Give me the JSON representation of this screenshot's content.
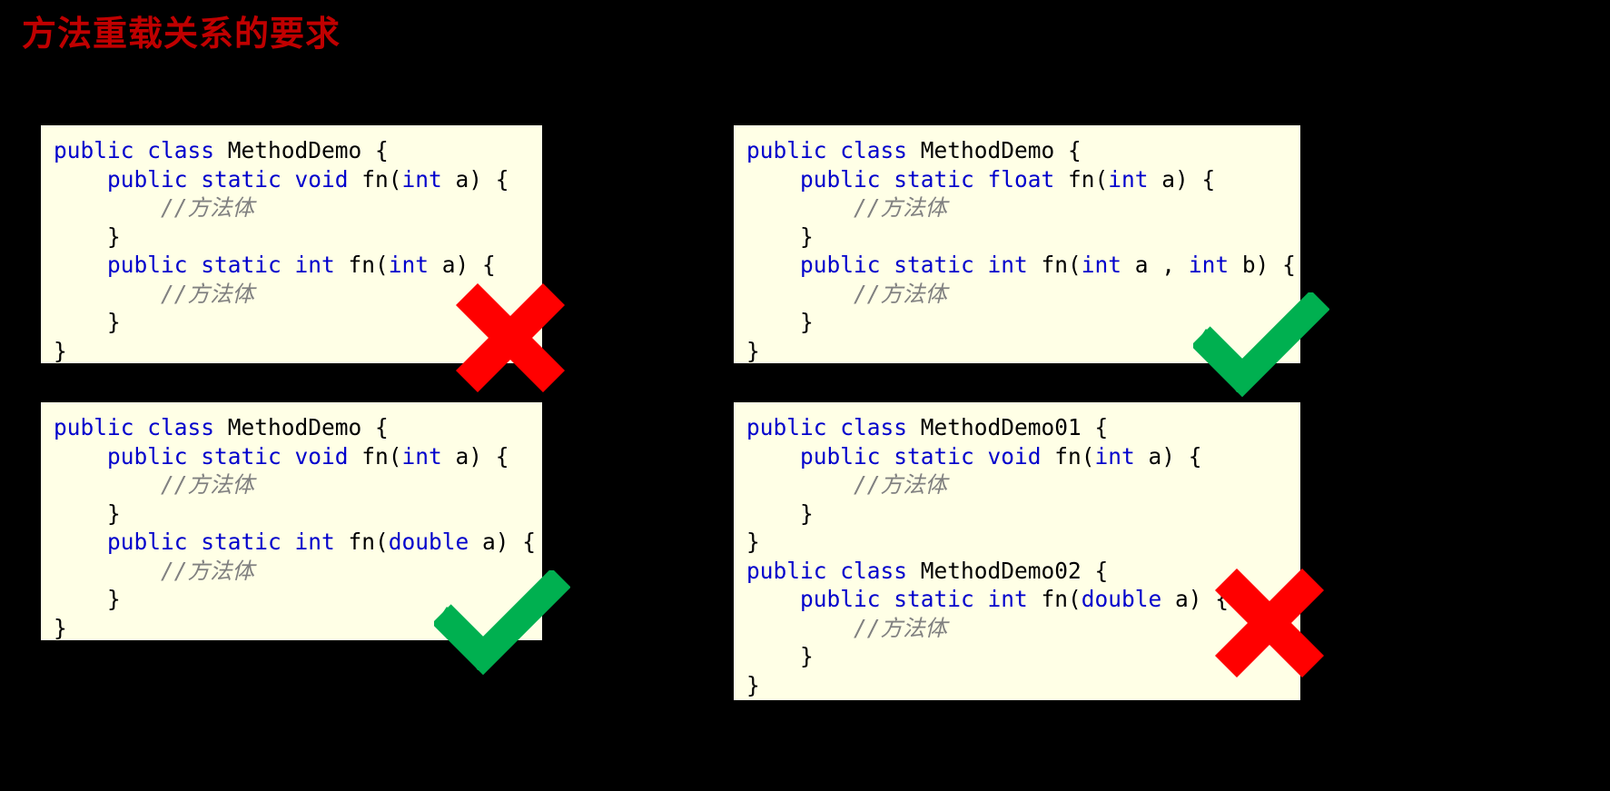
{
  "slide": {
    "title": "方法重载关系的要求",
    "title_color": "#C00000",
    "background_color": "#000000",
    "code_background_color": "#FFFFE6",
    "keyword_color": "#0000CC",
    "comment_color": "#808080",
    "cross_color": "#FF0000",
    "check_color": "#00B050"
  },
  "code_boxes": [
    {
      "id": "code-box-1",
      "verdict": "invalid",
      "verdict_mark": "cross-mark",
      "lines": [
        [
          {
            "t": "public class ",
            "c": "kw"
          },
          {
            "t": "MethodDemo {",
            "c": "id"
          }
        ],
        [
          {
            "t": "    public static void ",
            "c": "kw"
          },
          {
            "t": "fn(",
            "c": "id"
          },
          {
            "t": "int",
            "c": "kw"
          },
          {
            "t": " a) {",
            "c": "id"
          }
        ],
        [
          {
            "t": "        //方法体",
            "c": "cmt"
          }
        ],
        [
          {
            "t": "    }",
            "c": "id"
          }
        ],
        [
          {
            "t": "    public static int ",
            "c": "kw"
          },
          {
            "t": "fn(",
            "c": "id"
          },
          {
            "t": "int",
            "c": "kw"
          },
          {
            "t": " a) {",
            "c": "id"
          }
        ],
        [
          {
            "t": "        //方法体",
            "c": "cmt"
          }
        ],
        [
          {
            "t": "    }",
            "c": "id"
          }
        ],
        [
          {
            "t": "}",
            "c": "id"
          }
        ]
      ]
    },
    {
      "id": "code-box-2",
      "verdict": "valid",
      "verdict_mark": "check-mark",
      "lines": [
        [
          {
            "t": "public class ",
            "c": "kw"
          },
          {
            "t": "MethodDemo {",
            "c": "id"
          }
        ],
        [
          {
            "t": "    public static float ",
            "c": "kw"
          },
          {
            "t": "fn(",
            "c": "id"
          },
          {
            "t": "int",
            "c": "kw"
          },
          {
            "t": " a) {",
            "c": "id"
          }
        ],
        [
          {
            "t": "        //方法体",
            "c": "cmt"
          }
        ],
        [
          {
            "t": "    }",
            "c": "id"
          }
        ],
        [
          {
            "t": "    public static int ",
            "c": "kw"
          },
          {
            "t": "fn(",
            "c": "id"
          },
          {
            "t": "int",
            "c": "kw"
          },
          {
            "t": " a , ",
            "c": "id"
          },
          {
            "t": "int",
            "c": "kw"
          },
          {
            "t": " b) {",
            "c": "id"
          }
        ],
        [
          {
            "t": "        //方法体",
            "c": "cmt"
          }
        ],
        [
          {
            "t": "    }",
            "c": "id"
          }
        ],
        [
          {
            "t": "}",
            "c": "id"
          }
        ]
      ]
    },
    {
      "id": "code-box-3",
      "verdict": "valid",
      "verdict_mark": "check-mark",
      "lines": [
        [
          {
            "t": "public class ",
            "c": "kw"
          },
          {
            "t": "MethodDemo {",
            "c": "id"
          }
        ],
        [
          {
            "t": "    public static void ",
            "c": "kw"
          },
          {
            "t": "fn(",
            "c": "id"
          },
          {
            "t": "int",
            "c": "kw"
          },
          {
            "t": " a) {",
            "c": "id"
          }
        ],
        [
          {
            "t": "        //方法体",
            "c": "cmt"
          }
        ],
        [
          {
            "t": "    }",
            "c": "id"
          }
        ],
        [
          {
            "t": "    public static int ",
            "c": "kw"
          },
          {
            "t": "fn(",
            "c": "id"
          },
          {
            "t": "double",
            "c": "kw"
          },
          {
            "t": " a) {",
            "c": "id"
          }
        ],
        [
          {
            "t": "        //方法体",
            "c": "cmt"
          }
        ],
        [
          {
            "t": "    }",
            "c": "id"
          }
        ],
        [
          {
            "t": "}",
            "c": "id"
          }
        ]
      ]
    },
    {
      "id": "code-box-4",
      "verdict": "invalid",
      "verdict_mark": "cross-mark",
      "lines": [
        [
          {
            "t": "public class ",
            "c": "kw"
          },
          {
            "t": "MethodDemo01 {",
            "c": "id"
          }
        ],
        [
          {
            "t": "    public static void ",
            "c": "kw"
          },
          {
            "t": "fn(",
            "c": "id"
          },
          {
            "t": "int",
            "c": "kw"
          },
          {
            "t": " a) {",
            "c": "id"
          }
        ],
        [
          {
            "t": "        //方法体",
            "c": "cmt"
          }
        ],
        [
          {
            "t": "    }",
            "c": "id"
          }
        ],
        [
          {
            "t": "}",
            "c": "id"
          }
        ],
        [
          {
            "t": "public class ",
            "c": "kw"
          },
          {
            "t": "MethodDemo02 {",
            "c": "id"
          }
        ],
        [
          {
            "t": "    public static int ",
            "c": "kw"
          },
          {
            "t": "fn(",
            "c": "id"
          },
          {
            "t": "double",
            "c": "kw"
          },
          {
            "t": " a) {",
            "c": "id"
          }
        ],
        [
          {
            "t": "        //方法体",
            "c": "cmt"
          }
        ],
        [
          {
            "t": "    }",
            "c": "id"
          }
        ],
        [
          {
            "t": "}",
            "c": "id"
          }
        ]
      ]
    }
  ],
  "marks": [
    {
      "id": "mark-cross-1",
      "type": "cross-mark",
      "color": "#FF0000"
    },
    {
      "id": "mark-check-1",
      "type": "check-mark",
      "color": "#00B050"
    },
    {
      "id": "mark-check-2",
      "type": "check-mark",
      "color": "#00B050"
    },
    {
      "id": "mark-cross-2",
      "type": "cross-mark",
      "color": "#FF0000"
    }
  ]
}
